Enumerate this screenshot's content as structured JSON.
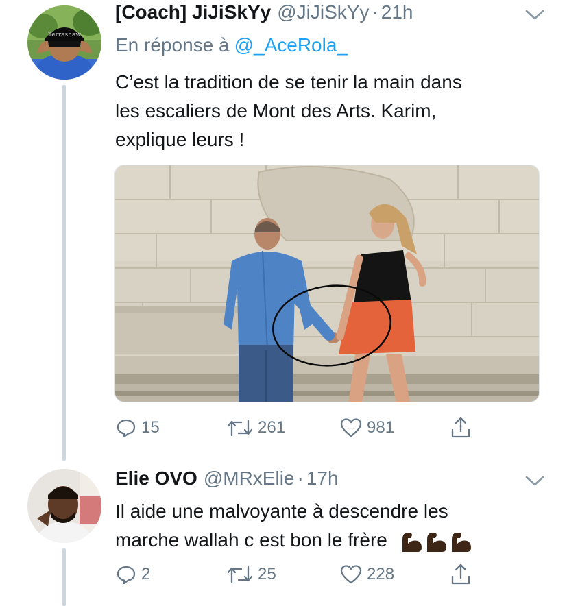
{
  "tweets": [
    {
      "display_name": "[Coach] JiJiSkYy",
      "handle": "@JiJiSkYy",
      "separator": "·",
      "time": "21h",
      "reply_prefix": "En réponse à",
      "reply_to": "@_AceRola_",
      "text_lines": [
        "C’est la tradition de se tenir la main dans",
        "les escaliers de Mont des Arts. Karim,",
        "explique leurs !"
      ],
      "actions": {
        "replies": "15",
        "retweets": "261",
        "likes": "981"
      },
      "media_icon_text": "Terrashaw"
    },
    {
      "display_name": "Elie OVO",
      "handle": "@MRxElie",
      "separator": "·",
      "time": "17h",
      "text_lines": [
        "Il aide une malvoyante à descendre les",
        "marche wallah c est bon le frère"
      ],
      "emoji": "flexed-biceps-dark-skin x3",
      "actions": {
        "replies": "2",
        "retweets": "25",
        "likes": "228"
      }
    }
  ],
  "icons": {
    "reply": "reply-icon",
    "retweet": "retweet-icon",
    "like": "heart-icon",
    "share": "share-icon",
    "menu": "chevron-down-icon"
  },
  "colors": {
    "text": "#14171a",
    "secondary": "#657786",
    "link": "#1da1f2",
    "thread_line": "#ccd6dd"
  }
}
